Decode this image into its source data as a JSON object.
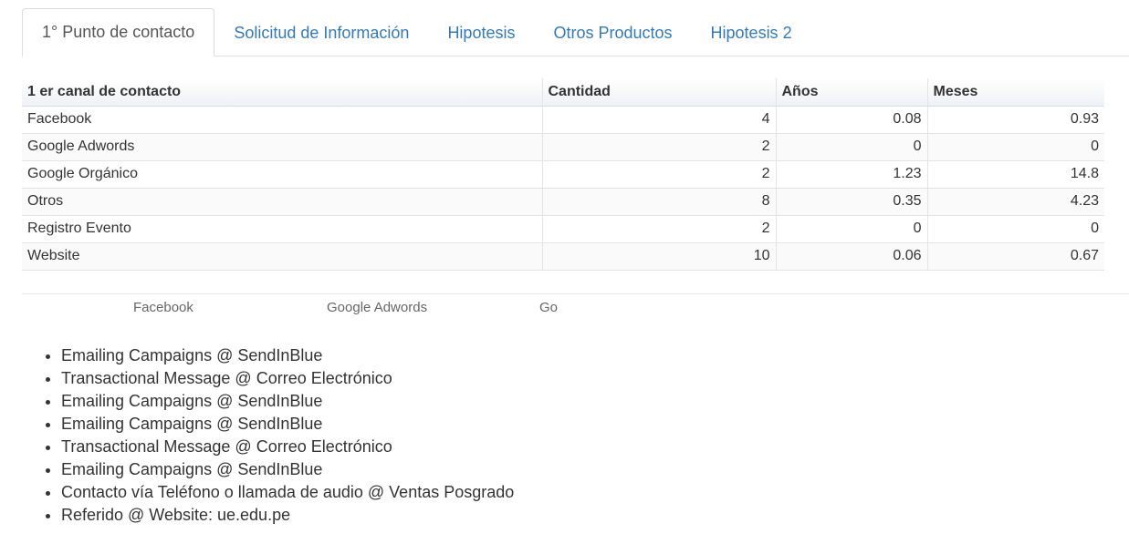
{
  "tabs": [
    {
      "label": "1° Punto de contacto",
      "active": true
    },
    {
      "label": "Solicitud de Información",
      "active": false
    },
    {
      "label": "Hipotesis",
      "active": false
    },
    {
      "label": "Otros Productos",
      "active": false
    },
    {
      "label": "Hipotesis 2",
      "active": false
    }
  ],
  "table": {
    "headers": [
      "1 er canal de contacto",
      "Cantidad",
      "Años",
      "Meses"
    ],
    "rows": [
      [
        "Facebook",
        "4",
        "0.08",
        "0.93"
      ],
      [
        "Google Adwords",
        "2",
        "0",
        "0"
      ],
      [
        "Google Orgánico",
        "2",
        "1.23",
        "14.8"
      ],
      [
        "Otros",
        "8",
        "0.35",
        "4.23"
      ],
      [
        "Registro Evento",
        "2",
        "0",
        "0"
      ],
      [
        "Website",
        "10",
        "0.06",
        "0.67"
      ]
    ]
  },
  "chart_labels": [
    "Facebook",
    "Google Adwords",
    "Go"
  ],
  "events": [
    "Emailing Campaigns @ SendInBlue",
    "Transactional Message @ Correo Electrónico",
    "Emailing Campaigns @ SendInBlue",
    "Emailing Campaigns @ SendInBlue",
    "Transactional Message @ Correo Electrónico",
    "Emailing Campaigns @ SendInBlue",
    "Contacto vía Teléfono o llamada de audio @ Ventas Posgrado",
    "Referido @ Website: ue.edu.pe"
  ]
}
